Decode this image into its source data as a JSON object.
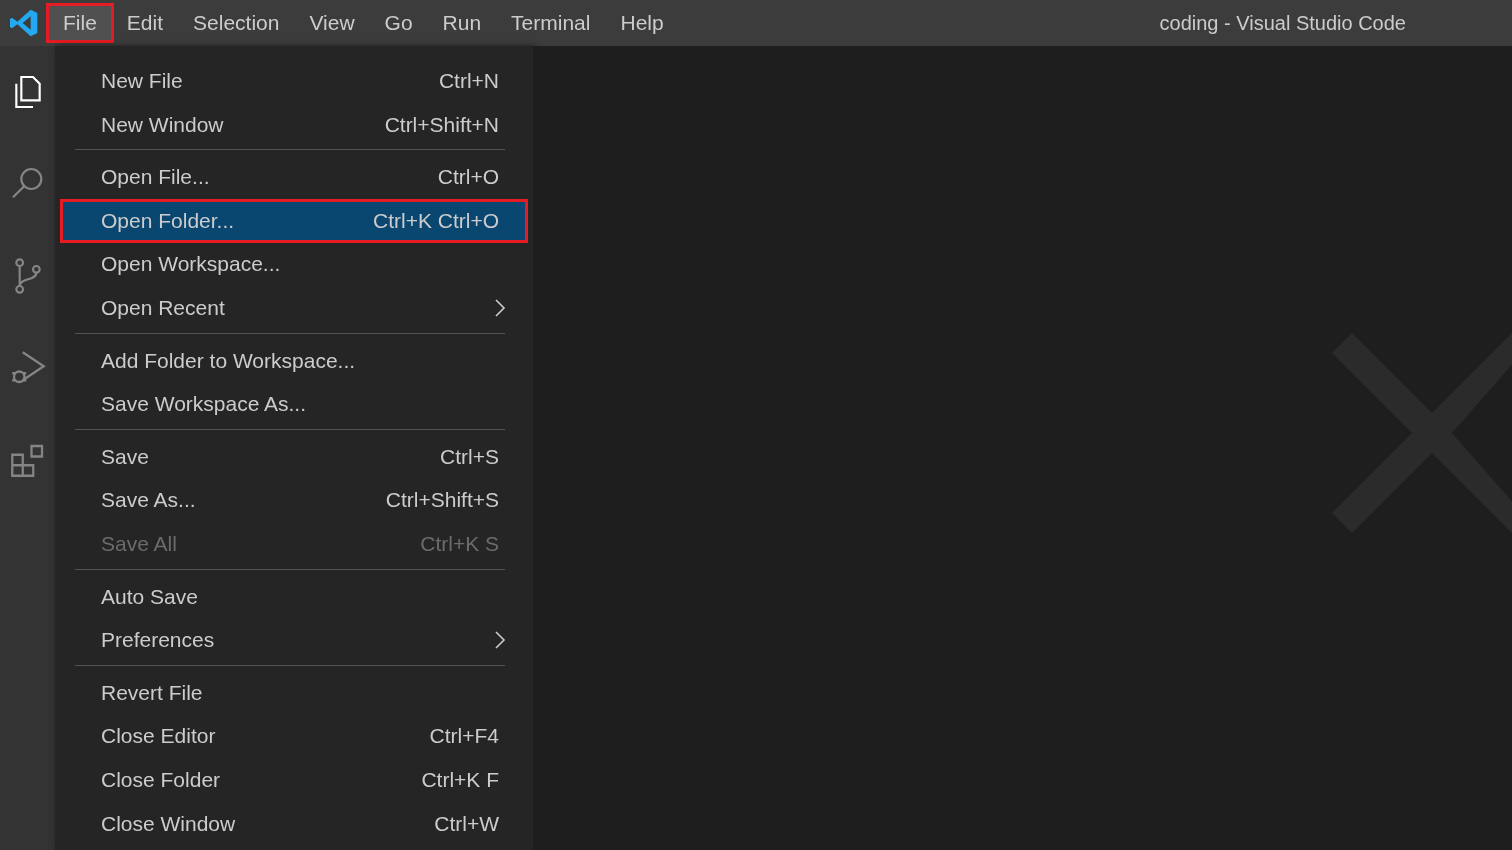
{
  "title_bar": {
    "title": "coding - Visual Studio Code"
  },
  "menu_bar": [
    {
      "label": "File",
      "selected": true,
      "outlined": true
    },
    {
      "label": "Edit",
      "selected": false,
      "outlined": false
    },
    {
      "label": "Selection",
      "selected": false,
      "outlined": false
    },
    {
      "label": "View",
      "selected": false,
      "outlined": false
    },
    {
      "label": "Go",
      "selected": false,
      "outlined": false
    },
    {
      "label": "Run",
      "selected": false,
      "outlined": false
    },
    {
      "label": "Terminal",
      "selected": false,
      "outlined": false
    },
    {
      "label": "Help",
      "selected": false,
      "outlined": false
    }
  ],
  "activity_bar": [
    {
      "kind": "explorer",
      "selected": true
    },
    {
      "kind": "search",
      "selected": false
    },
    {
      "kind": "source-control",
      "selected": false
    },
    {
      "kind": "run-debug",
      "selected": false
    },
    {
      "kind": "extensions",
      "selected": false
    }
  ],
  "file_menu": [
    {
      "kind": "item",
      "label": "New File",
      "shortcut": "Ctrl+N",
      "selected": false,
      "disabled": false,
      "outlined": false,
      "submenu": false
    },
    {
      "kind": "item",
      "label": "New Window",
      "shortcut": "Ctrl+Shift+N",
      "selected": false,
      "disabled": false,
      "outlined": false,
      "submenu": false
    },
    {
      "kind": "separator"
    },
    {
      "kind": "item",
      "label": "Open File...",
      "shortcut": "Ctrl+O",
      "selected": false,
      "disabled": false,
      "outlined": false,
      "submenu": false
    },
    {
      "kind": "item",
      "label": "Open Folder...",
      "shortcut": "Ctrl+K Ctrl+O",
      "selected": true,
      "disabled": false,
      "outlined": true,
      "submenu": false
    },
    {
      "kind": "item",
      "label": "Open Workspace...",
      "selected": false,
      "disabled": false,
      "outlined": false,
      "submenu": false
    },
    {
      "kind": "item",
      "label": "Open Recent",
      "selected": false,
      "disabled": false,
      "outlined": false,
      "submenu": true
    },
    {
      "kind": "separator"
    },
    {
      "kind": "item",
      "label": "Add Folder to Workspace...",
      "selected": false,
      "disabled": false,
      "outlined": false,
      "submenu": false
    },
    {
      "kind": "item",
      "label": "Save Workspace As...",
      "selected": false,
      "disabled": false,
      "outlined": false,
      "submenu": false
    },
    {
      "kind": "separator"
    },
    {
      "kind": "item",
      "label": "Save",
      "shortcut": "Ctrl+S",
      "selected": false,
      "disabled": false,
      "outlined": false,
      "submenu": false
    },
    {
      "kind": "item",
      "label": "Save As...",
      "shortcut": "Ctrl+Shift+S",
      "selected": false,
      "disabled": false,
      "outlined": false,
      "submenu": false
    },
    {
      "kind": "item",
      "label": "Save All",
      "shortcut": "Ctrl+K S",
      "selected": false,
      "disabled": true,
      "outlined": false,
      "submenu": false
    },
    {
      "kind": "separator"
    },
    {
      "kind": "item",
      "label": "Auto Save",
      "selected": false,
      "disabled": false,
      "outlined": false,
      "submenu": false
    },
    {
      "kind": "item",
      "label": "Preferences",
      "selected": false,
      "disabled": false,
      "outlined": false,
      "submenu": true
    },
    {
      "kind": "separator"
    },
    {
      "kind": "item",
      "label": "Revert File",
      "selected": false,
      "disabled": false,
      "outlined": false,
      "submenu": false
    },
    {
      "kind": "item",
      "label": "Close Editor",
      "shortcut": "Ctrl+F4",
      "selected": false,
      "disabled": false,
      "outlined": false,
      "submenu": false
    },
    {
      "kind": "item",
      "label": "Close Folder",
      "shortcut": "Ctrl+K F",
      "selected": false,
      "disabled": false,
      "outlined": false,
      "submenu": false
    },
    {
      "kind": "item",
      "label": "Close Window",
      "shortcut": "Ctrl+W",
      "selected": false,
      "disabled": false,
      "outlined": false,
      "submenu": false
    }
  ]
}
